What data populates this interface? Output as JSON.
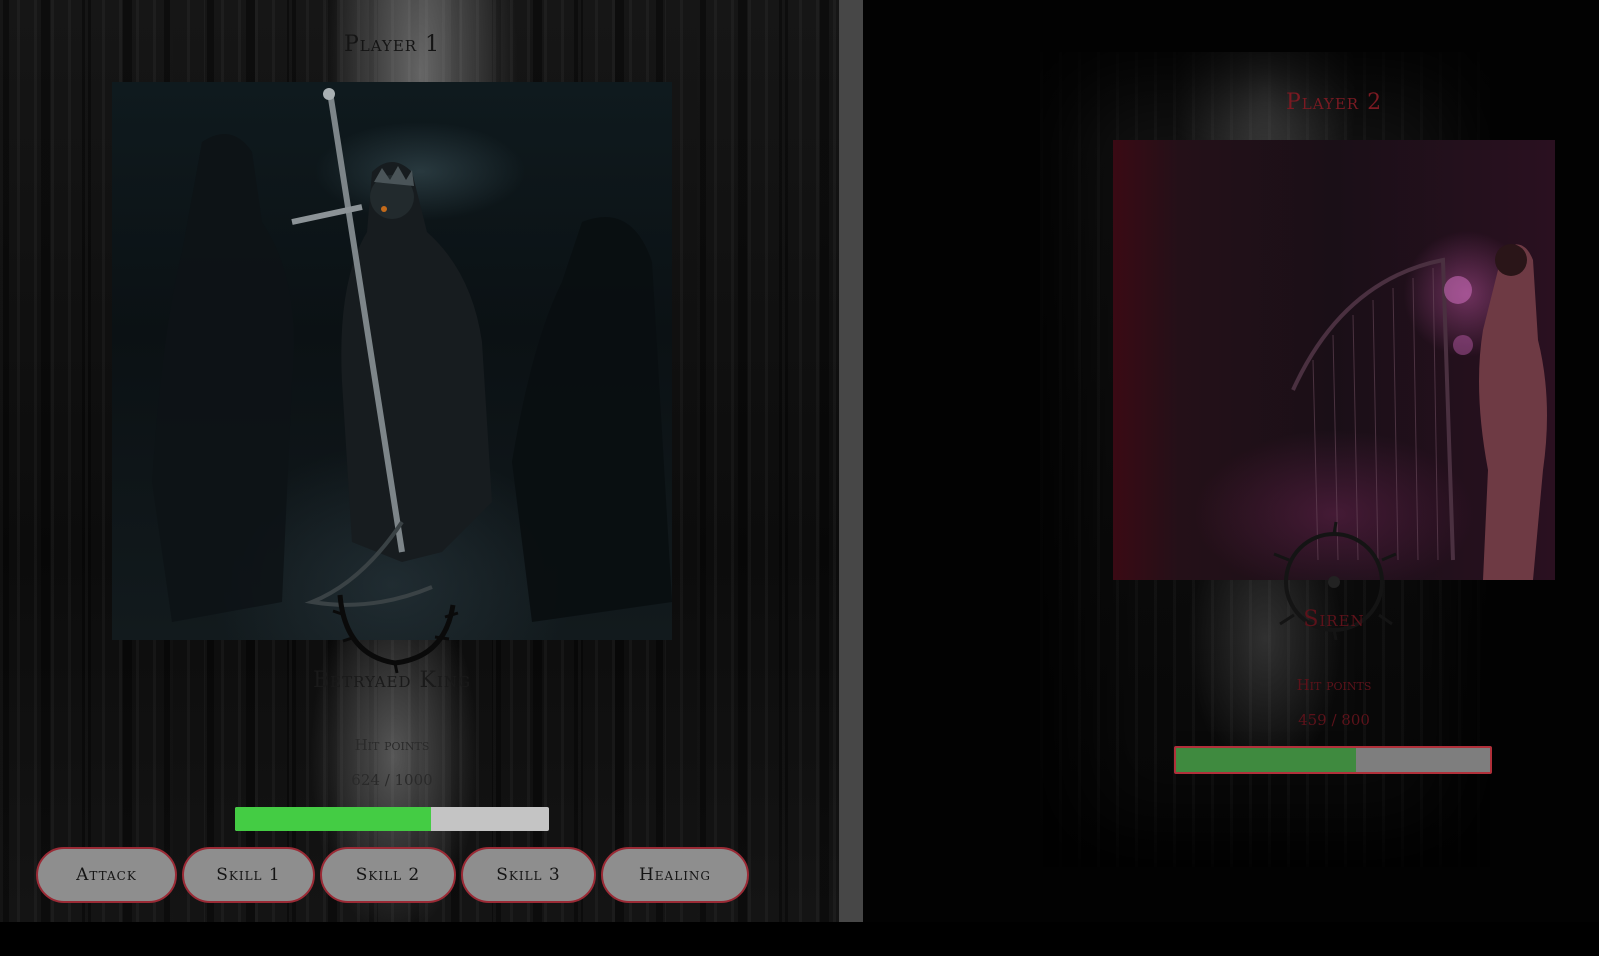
{
  "player1": {
    "label": "Player 1",
    "character_name": "Betryaed King",
    "hp_label": "Hit points",
    "hp_text": "624 / 1000",
    "hp_current": 624,
    "hp_max": 1000,
    "hp_color": "#44cc44"
  },
  "player2": {
    "label": "Player 2",
    "character_name": "Siren",
    "hp_label": "Hit points",
    "hp_text": "459 / 800",
    "hp_current": 459,
    "hp_max": 800,
    "hp_color": "#3f8a3f",
    "accent_color": "#9a2a35"
  },
  "actions": {
    "attack": "Attack",
    "skill1": "Skill 1",
    "skill2": "Skill 2",
    "skill3": "Skill 3",
    "healing": "Healing"
  }
}
